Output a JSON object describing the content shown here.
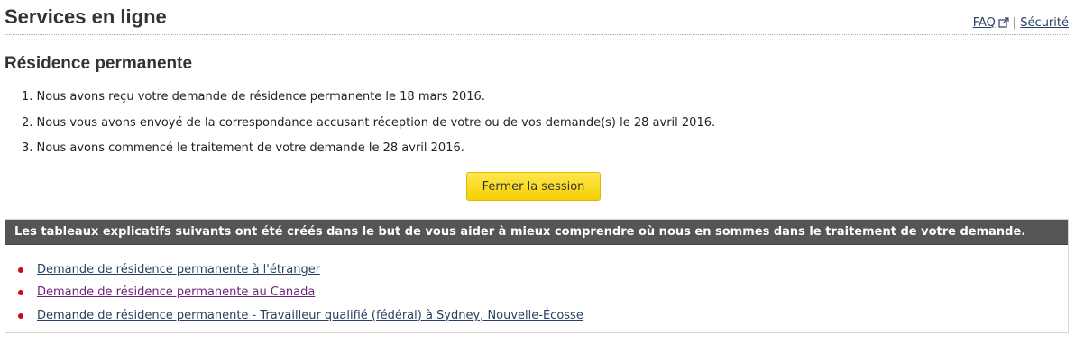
{
  "header": {
    "title": "Services en ligne",
    "links": {
      "faq": "FAQ",
      "separator": "|",
      "security": "Sécurité"
    }
  },
  "section": {
    "title": "Résidence permanente",
    "steps": [
      "1. Nous avons reçu votre demande de résidence permanente le 18 mars 2016.",
      "2. Nous vous avons envoyé de la correspondance accusant réception de votre ou de vos demande(s) le 28 avril 2016.",
      "3. Nous avons commencé le traitement de votre demande le 28 avril 2016."
    ],
    "logout_label": "Fermer la session"
  },
  "info": {
    "header": "Les tableaux explicatifs suivants ont été créés dans le but de vous aider à mieux comprendre où nous en sommes dans le traitement de votre demande.",
    "links": [
      "Demande de résidence permanente à l'étranger",
      "Demande de résidence permanente au Canada",
      "Demande de résidence permanente - Travailleur qualifié (fédéral) à Sydney, Nouvelle-Écosse"
    ]
  },
  "colors": {
    "link": "#284162",
    "visited_link": "#6a2576",
    "button_bg": "#fcdc2c",
    "panel_header_bg": "#555555",
    "bullet": "#d3080c"
  },
  "icons": {
    "faq_external": "external-link-icon",
    "bullet": "bullet-icon"
  }
}
